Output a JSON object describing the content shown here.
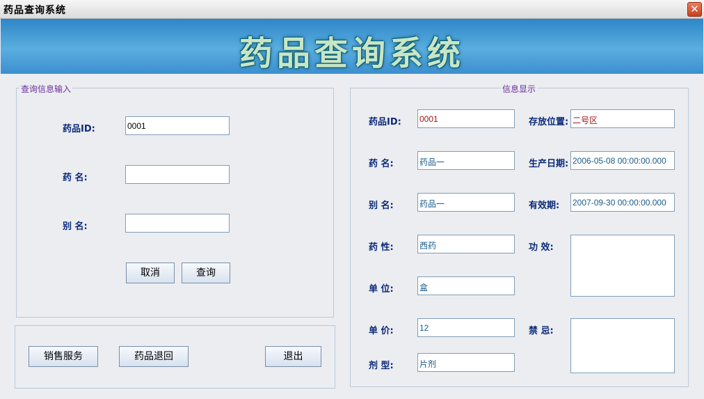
{
  "window": {
    "title": "药品查询系统",
    "close_glyph": "✕"
  },
  "banner": {
    "title": "药品查询系统"
  },
  "query_panel": {
    "legend": "查询信息输入",
    "drug_id_label": "药品ID:",
    "drug_id_value": "0001",
    "drug_name_label": "药 名:",
    "drug_name_value": "",
    "alias_label": "别 名:",
    "alias_value": "",
    "cancel_label": "取消",
    "query_label": "查询"
  },
  "actions": {
    "sales_label": "销售服务",
    "return_label": "药品退回",
    "exit_label": "退出"
  },
  "info_panel": {
    "legend": "信息显示",
    "drug_id_label": "药品ID:",
    "drug_id_value": "0001",
    "location_label": "存放位置:",
    "location_value": "二号区",
    "name_label": "药 名:",
    "name_value": "药品一",
    "mfg_date_label": "生产日期:",
    "mfg_date_value": "2006-05-08 00:00:00.000",
    "alias_label": "别 名:",
    "alias_value": "药品一",
    "expiry_label": "有效期:",
    "expiry_value": "2007-09-30 00:00:00.000",
    "type_label": "药 性:",
    "type_value": "西药",
    "efficacy_label": "功 效:",
    "efficacy_value": "",
    "unit_label": "单 位:",
    "unit_value": "盒",
    "price_label": "单 价:",
    "price_value": "12",
    "contraindication_label": "禁 忌:",
    "contraindication_value": "",
    "form_label": "剂 型:",
    "form_value": "片剂"
  },
  "colors": {
    "banner": "#4a9fd8",
    "label": "#0b2a7a",
    "legend": "#6a2fa0",
    "value_red": "#a01515",
    "value_blue": "#1a5a8a"
  }
}
